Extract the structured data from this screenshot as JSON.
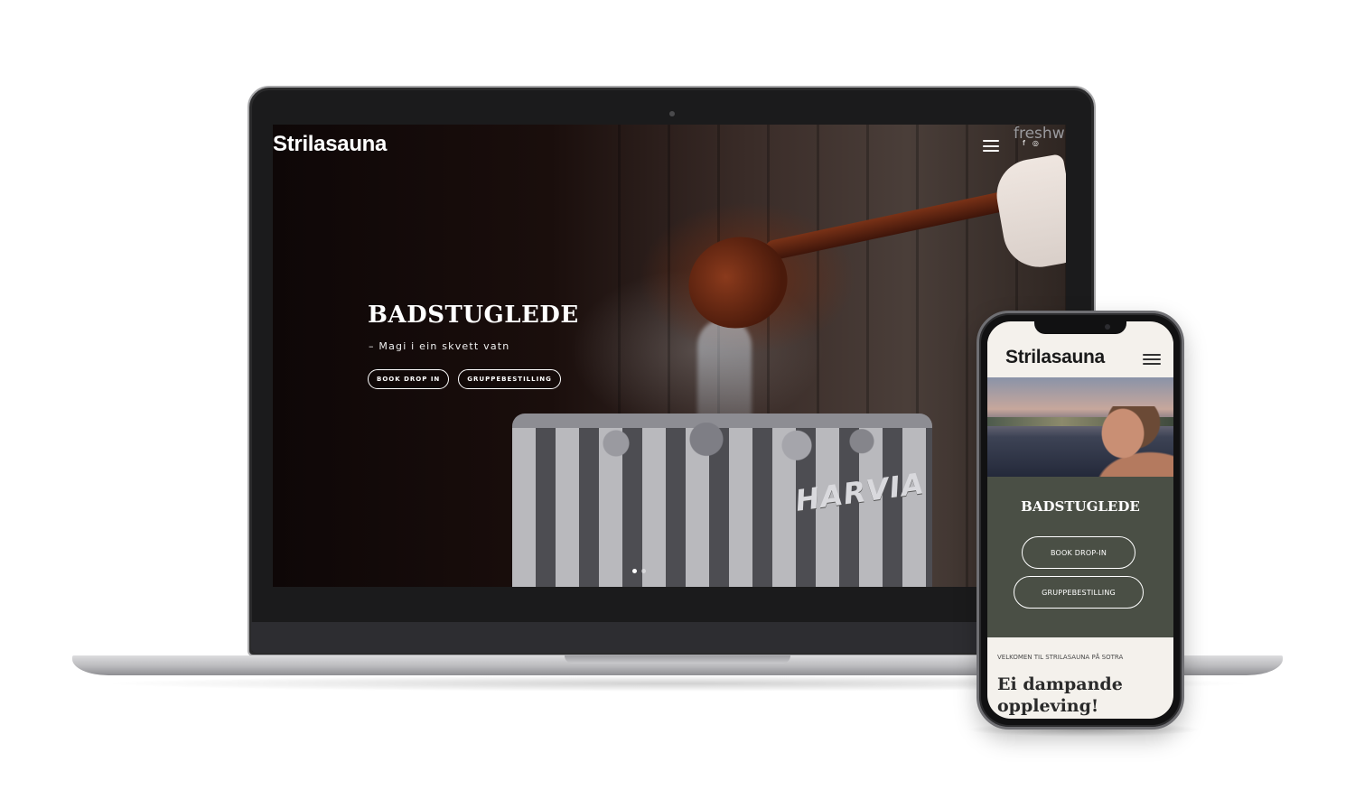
{
  "desktop": {
    "logo": "Strilasauna",
    "hero": {
      "title": "BADSTUGLEDE",
      "subtitle": "– Magi i ein skvett vatn",
      "buttons": [
        "BOOK DROP IN",
        "GRUPPEBESTILLING"
      ]
    },
    "social": {
      "facebook": "f",
      "instagram": "◎"
    },
    "photo_text": {
      "brand": "HARVIA",
      "sign": "freshw"
    }
  },
  "mobile": {
    "logo": "Strilasauna",
    "hero": {
      "title": "BADSTUGLEDE",
      "buttons": [
        "BOOK DROP-IN",
        "GRUPPEBESTILLING"
      ]
    },
    "welcome": "VELKOMEN TIL STRILASAUNA PÅ SOTRA",
    "headline": "Ei dampande oppleving!"
  }
}
